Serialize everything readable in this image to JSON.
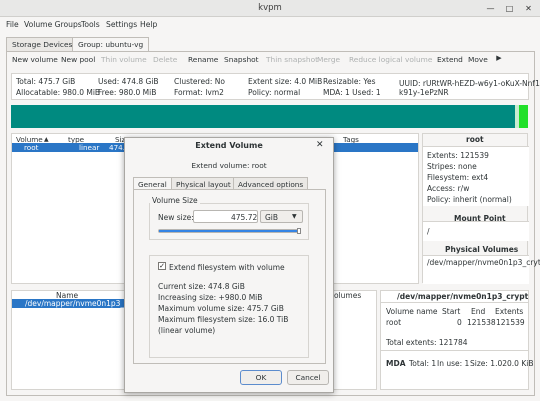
{
  "window": {
    "title": "kvpm",
    "min_icon": "minimize-icon",
    "max_icon": "maximize-icon",
    "close_icon": "close-icon"
  },
  "menu": [
    "File",
    "Volume Groups",
    "Tools",
    "Settings",
    "Help"
  ],
  "tabs": [
    "Storage Devices",
    "Group: ubuntu-vg"
  ],
  "toolbar": {
    "items": [
      {
        "label": "New volume",
        "enabled": true
      },
      {
        "label": "New pool",
        "enabled": true
      },
      {
        "label": "Thin volume",
        "enabled": false
      },
      {
        "label": "Delete",
        "enabled": false
      },
      {
        "label": "Rename",
        "enabled": true
      },
      {
        "label": "Snapshot",
        "enabled": true
      },
      {
        "label": "Thin snapshot",
        "enabled": false
      },
      {
        "label": "Merge",
        "enabled": false
      },
      {
        "label": "Reduce logical volume",
        "enabled": false
      },
      {
        "label": "Extend",
        "enabled": true
      },
      {
        "label": "Move",
        "enabled": true
      }
    ],
    "overflow_icon": "chevron-right-icon"
  },
  "vg_info": {
    "total": "Total: 475.7 GiB",
    "allocatable": "Allocatable: 980.0 MiB",
    "used": "Used: 474.8 GiB",
    "free": "Free: 980.0 MiB",
    "clustered": "Clustered: No",
    "format": "Format: lvm2",
    "extent_size": "Extent size: 4.0 MiB",
    "policy": "Policy: normal",
    "resizable": "Resizable: Yes",
    "mda": "MDA: 1 Used: 1",
    "uuid1": "UUID: rURtWR-hEZD-w6y1-oKuX-Nnf1-",
    "uuid2": "k91y-1ePzNR"
  },
  "usage_bar": {
    "used_color": "#008a80",
    "free_color": "#c8ecd0",
    "marker_color": "#22e02a"
  },
  "lv_table": {
    "headers": [
      "Volume",
      "type",
      "Size",
      "Tags"
    ],
    "row": {
      "name": "root",
      "type": "linear",
      "size": "474."
    }
  },
  "root_panel": {
    "title": "root",
    "extents": "Extents: 121539",
    "stripes": "Stripes: none",
    "filesystem": "Filesystem: ext4",
    "access": "Access: r/w",
    "policy": "Policy: inherit (normal)",
    "mount_title": "Mount Point",
    "mount_value": "/",
    "pv_title": "Physical Volumes",
    "pv_value": "/dev/mapper/nvme0n1p3_cryt"
  },
  "pv_table": {
    "headers": [
      "Name",
      "olumes"
    ],
    "row": "/dev/mapper/nvme0n1p3_crypt"
  },
  "pv_panel": {
    "title": "/dev/mapper/nvme0n1p3_crypt",
    "col_volume": "Volume name",
    "col_start": "Start",
    "col_end": "End",
    "col_extents": "Extents",
    "row_name": "root",
    "row_start": "0",
    "row_end": "121538",
    "row_extents": "121539",
    "total": "Total extents: 121784",
    "mda_label": "MDA",
    "mda_total": "Total: 1",
    "mda_inuse": "In use: 1",
    "mda_size": "Size: 1.020.0 KiB"
  },
  "dialog": {
    "title": "Extend Volume",
    "subtitle": "Extend volume: root",
    "tabs": [
      "General",
      "Physical layout",
      "Advanced options"
    ],
    "volume_size_label": "Volume Size",
    "new_size_label": "New size:",
    "new_size_value": "475.72",
    "unit": "GiB",
    "slider_fraction": 0.98,
    "extend_fs_label": "Extend filesystem with volume",
    "extend_fs_checked": true,
    "current_size": "Current size: 474.8 GiB",
    "increasing_size": "Increasing size: +980.0 MiB",
    "max_volume_size": "Maximum volume size: 475.7 GiB",
    "max_fs_size": "Maximum filesystem size: 16.0 TiB",
    "linear": "(linear volume)",
    "ok": "OK",
    "cancel": "Cancel"
  }
}
